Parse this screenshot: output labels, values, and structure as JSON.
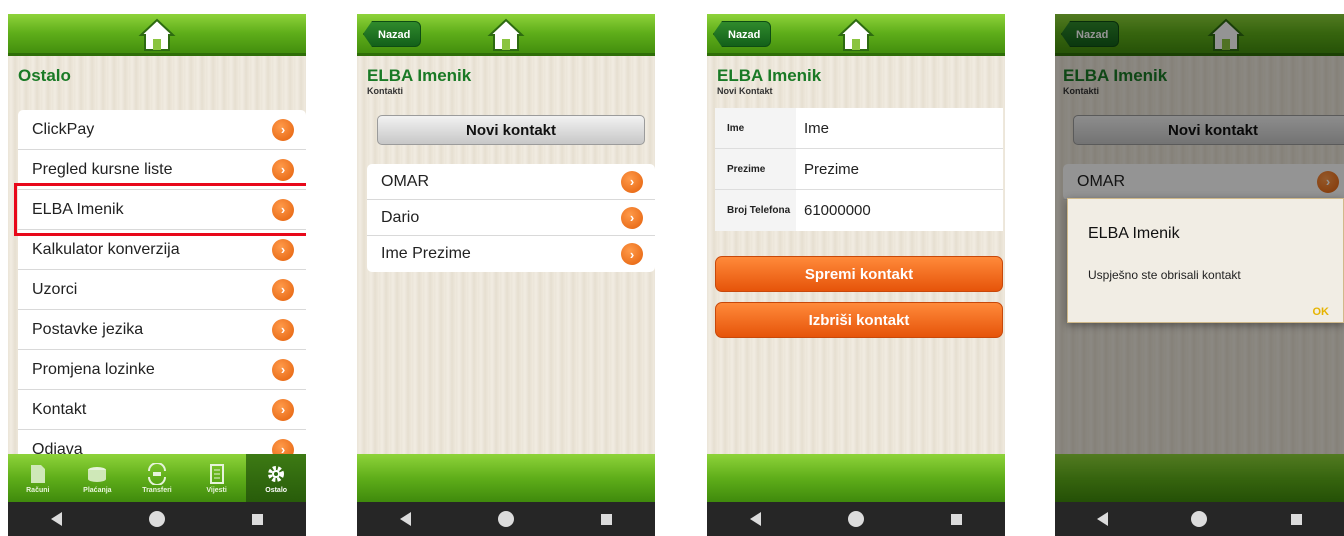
{
  "screen1": {
    "title": "Ostalo",
    "menu": [
      "ClickPay",
      "Pregled kursne liste",
      "ELBA Imenik",
      "Kalkulator konverzija",
      "Uzorci",
      "Postavke jezika",
      "Promjena lozinke",
      "Kontakt",
      "Odjava"
    ],
    "tabs": [
      "Računi",
      "Plaćanja",
      "Transferi",
      "Vijesti",
      "Ostalo"
    ]
  },
  "screen2": {
    "back_label": "Nazad",
    "title": "ELBA Imenik",
    "subtitle": "Kontakti",
    "new_contact": "Novi kontakt",
    "contacts": [
      "OMAR",
      "Dario",
      "Ime Prezime"
    ]
  },
  "screen3": {
    "back_label": "Nazad",
    "title": "ELBA Imenik",
    "subtitle": "Novi Kontakt",
    "fields": [
      {
        "label": "Ime",
        "value": "Ime"
      },
      {
        "label": "Prezime",
        "value": "Prezime"
      },
      {
        "label": "Broj Telefona",
        "value": "61000000"
      }
    ],
    "save_label": "Spremi kontakt",
    "delete_label": "Izbriši kontakt"
  },
  "screen4": {
    "back_label": "Nazad",
    "title": "ELBA Imenik",
    "subtitle": "Kontakti",
    "new_contact": "Novi kontakt",
    "first_contact": "OMAR",
    "dialog": {
      "title": "ELBA Imenik",
      "message": "Uspješno ste obrisali kontakt",
      "ok": "OK"
    }
  },
  "colors": {
    "accent_green": "#1a7a26",
    "bar_green": "#5fae1a",
    "arrow_orange": "#e35f0a",
    "highlight_red": "#e8081a",
    "dialog_ok": "#e6b400"
  }
}
